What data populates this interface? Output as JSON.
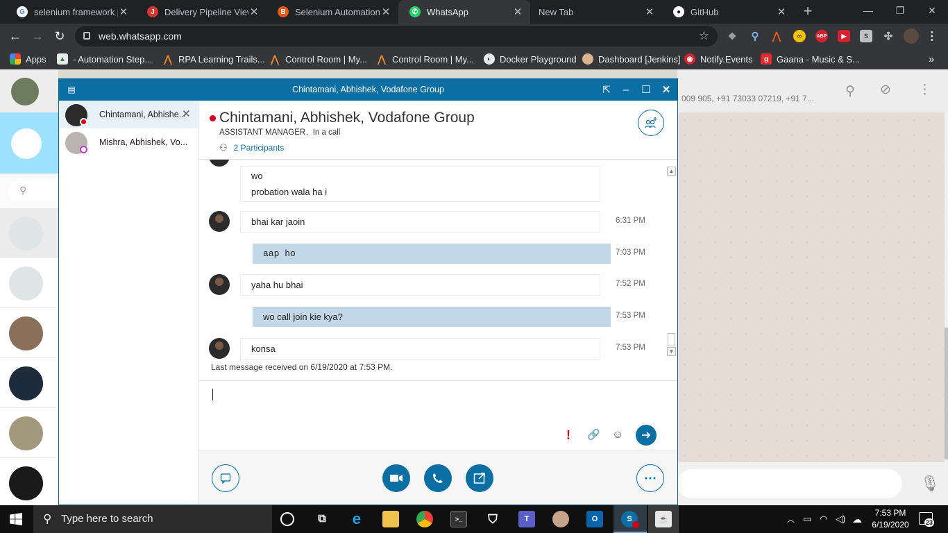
{
  "browser": {
    "tabs": [
      {
        "title": "selenium framework pr",
        "icon": "google-icon",
        "color": "#ffffff"
      },
      {
        "title": "Delivery Pipeline View [",
        "icon": "jenkins-icon",
        "color": "#d33833"
      },
      {
        "title": "Selenium Automation F",
        "icon": "browserstack-icon",
        "color": "#e8591a"
      },
      {
        "title": "WhatsApp",
        "icon": "whatsapp-icon",
        "color": "#25d366"
      },
      {
        "title": "New Tab",
        "icon": "",
        "color": ""
      },
      {
        "title": "GitHub",
        "icon": "github-icon",
        "color": "#ffffff"
      }
    ],
    "url": "web.whatsapp.com",
    "bookmarks": [
      {
        "label": "Apps",
        "icon": "apps-grid-icon"
      },
      {
        "label": "- Automation Step...",
        "icon": "triangle-icon"
      },
      {
        "label": "RPA Learning Trails...",
        "icon": "automation-anywhere-icon"
      },
      {
        "label": "Control Room | My...",
        "icon": "automation-anywhere-icon"
      },
      {
        "label": "Control Room | My...",
        "icon": "automation-anywhere-icon"
      },
      {
        "label": "Docker Playground",
        "icon": "docker-icon"
      },
      {
        "label": "Dashboard [Jenkins]",
        "icon": "jenkins-icon"
      },
      {
        "label": "Notify.Events",
        "icon": "notify-icon"
      },
      {
        "label": "Gaana - Music & S...",
        "icon": "gaana-icon"
      }
    ],
    "extensions": [
      {
        "label": "ABP",
        "color": "#d6212f"
      }
    ]
  },
  "whatsapp": {
    "header_participants": "009 905, +91 73033 07219, +91 7..."
  },
  "skype": {
    "window_title": "Chintamani, Abhishek, Vodafone Group",
    "conversations": [
      {
        "name": "Chintamani, Abhishe...",
        "status_color": "#d0021b"
      },
      {
        "name": "Mishra, Abhishek, Vo...",
        "status_color": "#b83ec6"
      }
    ],
    "contact": {
      "name": "Chintamani, Abhishek, Vodafone Group",
      "role": "ASSISTANT MANAGER ,  In a call",
      "participants": "2 Participants"
    },
    "messages": [
      {
        "direction": "in",
        "lines": [
          "wo",
          "probation wala ha i"
        ],
        "time": ""
      },
      {
        "direction": "in",
        "text": "bhai kar jaoin",
        "time": "6:31 PM"
      },
      {
        "direction": "out",
        "text": "aap ho",
        "time": "7:03 PM"
      },
      {
        "direction": "in",
        "text": "yaha hu bhai",
        "time": "7:52 PM"
      },
      {
        "direction": "out",
        "text": "wo call join kie kya?",
        "time": "7:53 PM"
      },
      {
        "direction": "in",
        "text": "konsa",
        "time": "7:53 PM"
      }
    ],
    "last_message": "Last message received on 6/19/2020 at 7:53 PM.",
    "compose_value": "",
    "accent": "#0b6fa4"
  },
  "taskbar": {
    "search_placeholder": "Type here to search",
    "time": "7:53 PM",
    "date": "6/19/2020",
    "notification_count": "23"
  }
}
